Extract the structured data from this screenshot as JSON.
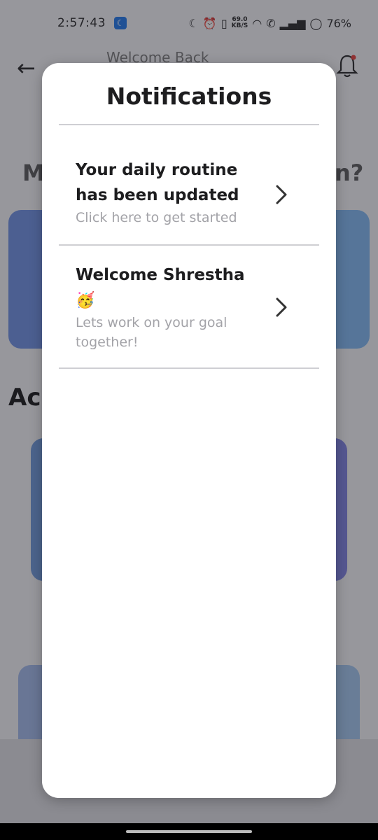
{
  "status_bar": {
    "time": "2:57:43",
    "net_speed_value": "69.0",
    "net_speed_unit": "KB/S",
    "battery": "76%"
  },
  "background": {
    "title": "Welcome Back",
    "heading_left": "M",
    "heading_right": "n?",
    "section_title": "Ac"
  },
  "modal": {
    "title": "Notifications",
    "items": [
      {
        "title": "Your daily routine has been updated",
        "subtitle": "Click here to get started"
      },
      {
        "title": "Welcome Shrestha",
        "emoji": "🥳",
        "subtitle": "Lets work on your goal together!"
      }
    ]
  },
  "colors": {
    "notification_badge": "#e53935",
    "modal_bg": "#ffffff",
    "primary_text": "#1d1d1f",
    "secondary_text": "#a3a3a8"
  }
}
